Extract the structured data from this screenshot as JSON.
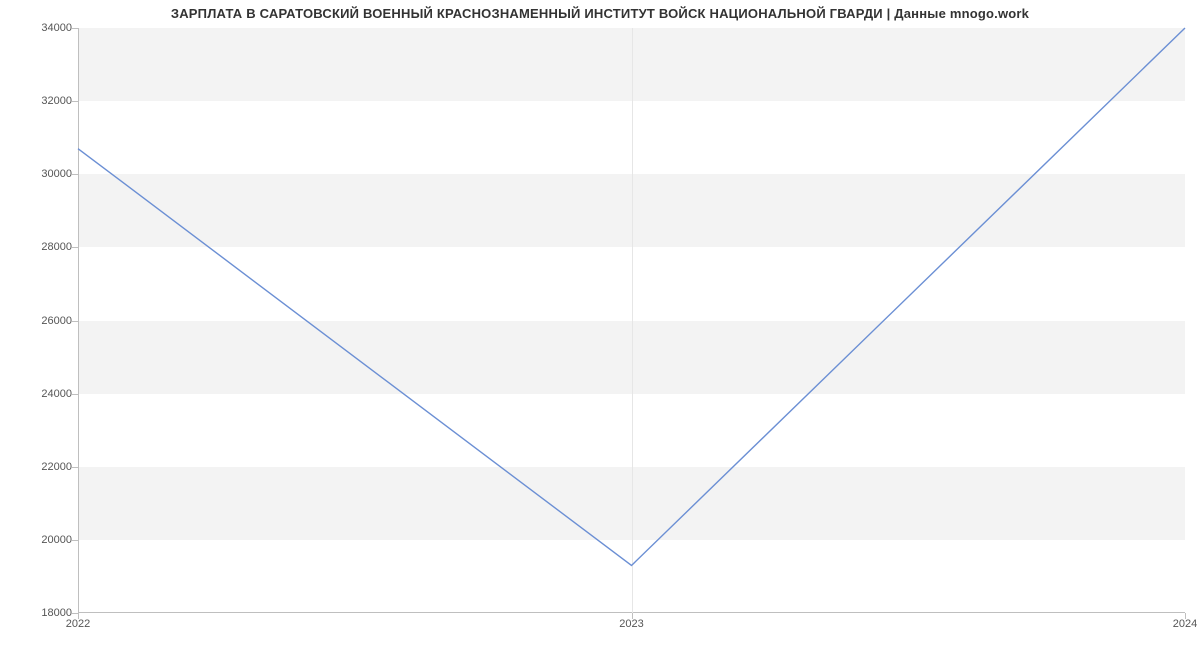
{
  "chart_data": {
    "type": "line",
    "title": "ЗАРПЛАТА В САРАТОВСКИЙ ВОЕННЫЙ КРАСНОЗНАМЕННЫЙ ИНСТИТУТ ВОЙСК НАЦИОНАЛЬНОЙ ГВАРДИ | Данные mnogo.work",
    "categories": [
      "2022",
      "2023",
      "2024"
    ],
    "values": [
      30700,
      19300,
      34000
    ],
    "xlabel": "",
    "ylabel": "",
    "ylim": [
      18000,
      34000
    ],
    "yticks": [
      18000,
      20000,
      22000,
      24000,
      26000,
      28000,
      30000,
      32000,
      34000
    ],
    "line_color": "#6b8fd4"
  }
}
